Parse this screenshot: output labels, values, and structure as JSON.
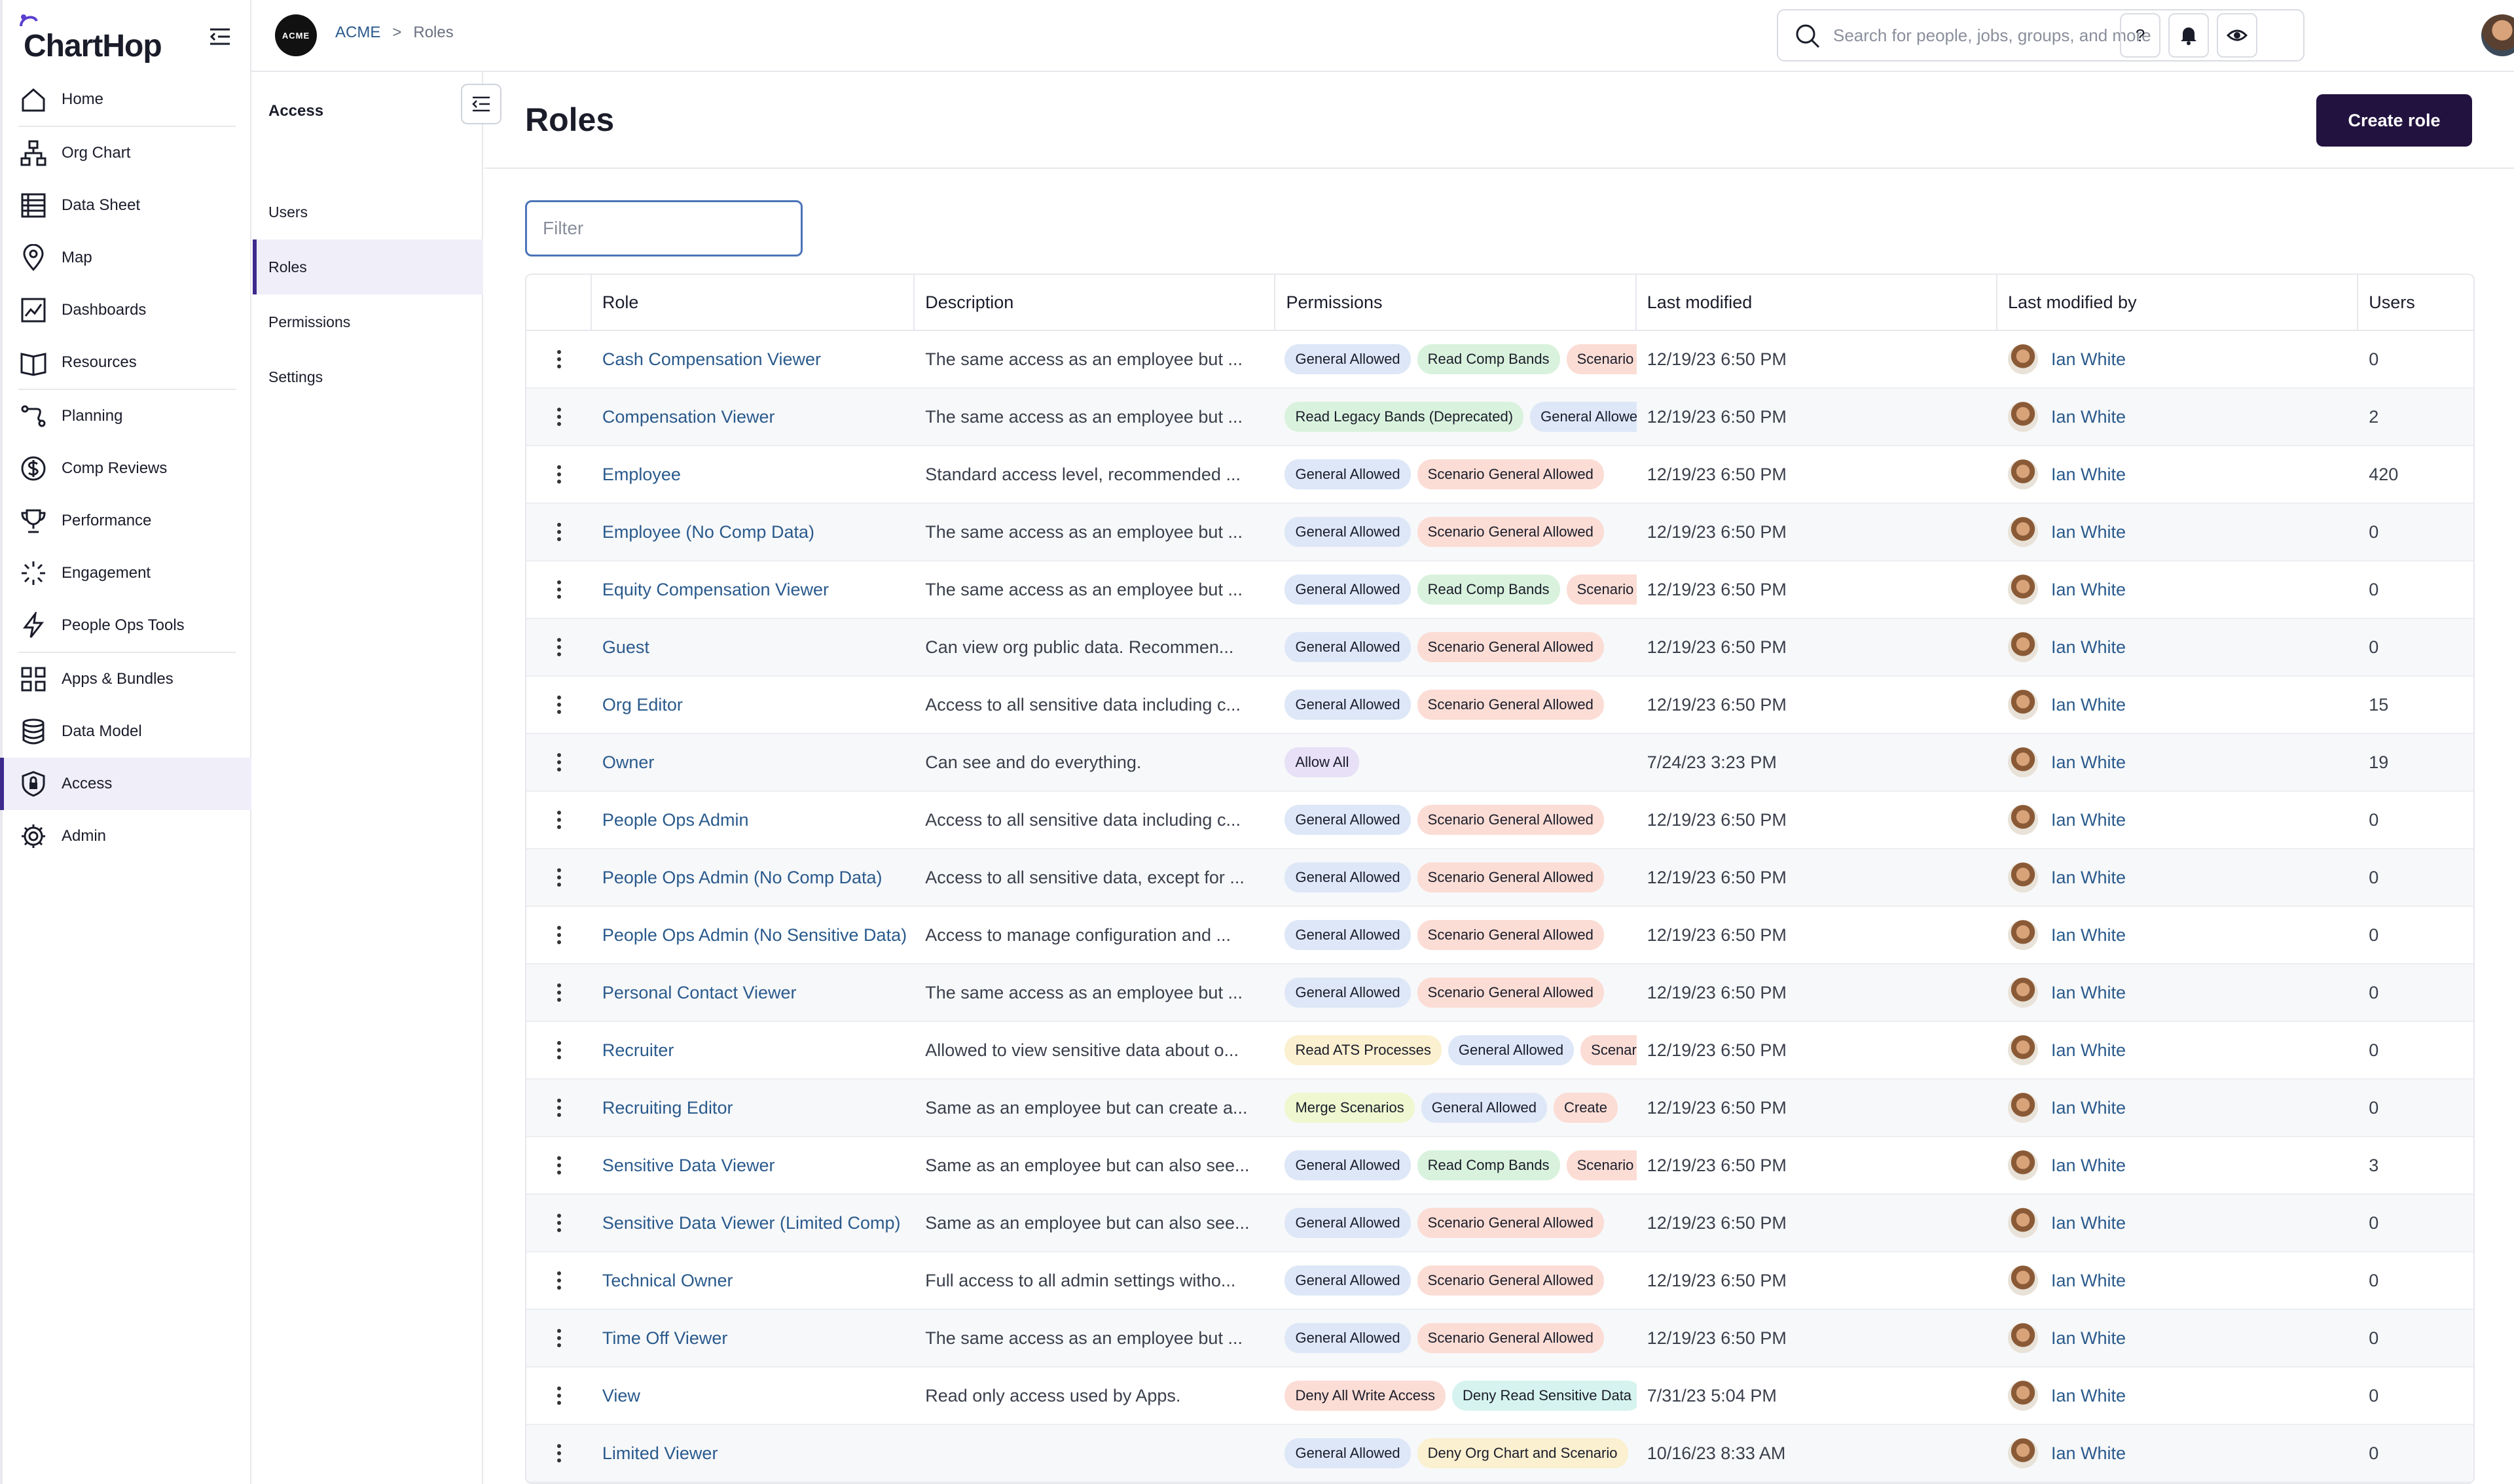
{
  "app": {
    "logo": "ChartHop"
  },
  "nav": {
    "items": [
      {
        "label": "Home",
        "icon": "home-icon"
      },
      {
        "label": "Org Chart",
        "icon": "org-chart-icon"
      },
      {
        "label": "Data Sheet",
        "icon": "table-icon"
      },
      {
        "label": "Map",
        "icon": "map-pin-icon"
      },
      {
        "label": "Dashboards",
        "icon": "dashboard-icon"
      },
      {
        "label": "Resources",
        "icon": "book-icon"
      },
      {
        "label": "Planning",
        "icon": "planning-icon"
      },
      {
        "label": "Comp Reviews",
        "icon": "dollar-icon"
      },
      {
        "label": "Performance",
        "icon": "trophy-icon"
      },
      {
        "label": "Engagement",
        "icon": "engagement-icon"
      },
      {
        "label": "People Ops Tools",
        "icon": "lightning-icon"
      },
      {
        "label": "Apps & Bundles",
        "icon": "apps-icon"
      },
      {
        "label": "Data Model",
        "icon": "database-icon"
      },
      {
        "label": "Access",
        "icon": "shield-icon"
      },
      {
        "label": "Admin",
        "icon": "gear-icon"
      }
    ],
    "active": "Access"
  },
  "topbar": {
    "org_avatar": "ACME",
    "breadcrumb": [
      "ACME",
      ">",
      "Roles"
    ],
    "search_placeholder": "Search for people, jobs, groups, and more",
    "help_label": "?"
  },
  "subnav": {
    "title": "Access",
    "items": [
      "Users",
      "Roles",
      "Permissions",
      "Settings"
    ],
    "active": "Roles"
  },
  "main": {
    "title": "Roles",
    "create_button": "Create role",
    "filter_placeholder": "Filter",
    "columns": [
      "Role",
      "Description",
      "Permissions",
      "Last modified",
      "Last modified by",
      "Users"
    ]
  },
  "tag_colors": {
    "General Allowed": "#dde7f7",
    "Read Comp Bands": "#d9f2dd",
    "Scenario General Allowed": "#fbddd5",
    "Read Legacy Bands (Deprecated)": "#d9f2dd",
    "Allow All": "#e7e0f6",
    "Read ATS Processes": "#fbf0cf",
    "Merge Scenarios": "#eef7cf",
    "Deny All Write Access": "#fbddd5",
    "Deny Read Sensitive Data": "#d6f3ef",
    "Deny Org Chart and Scenario": "#fbf0cf"
  },
  "rows": [
    {
      "role": "Cash Compensation Viewer",
      "desc": "The same access as an employee but ...",
      "perms": [
        "General Allowed",
        "Read Comp Bands",
        "Scenario General Allowed"
      ],
      "modified": "12/19/23 6:50 PM",
      "by": "Ian White",
      "users": "0"
    },
    {
      "role": "Compensation Viewer",
      "desc": "The same access as an employee but ...",
      "perms": [
        "Read Legacy Bands (Deprecated)",
        "General Allowed"
      ],
      "modified": "12/19/23 6:50 PM",
      "by": "Ian White",
      "users": "2"
    },
    {
      "role": "Employee",
      "desc": "Standard access level, recommended ...",
      "perms": [
        "General Allowed",
        "Scenario General Allowed"
      ],
      "modified": "12/19/23 6:50 PM",
      "by": "Ian White",
      "users": "420"
    },
    {
      "role": "Employee (No Comp Data)",
      "desc": "The same access as an employee but ...",
      "perms": [
        "General Allowed",
        "Scenario General Allowed"
      ],
      "modified": "12/19/23 6:50 PM",
      "by": "Ian White",
      "users": "0"
    },
    {
      "role": "Equity Compensation Viewer",
      "desc": "The same access as an employee but ...",
      "perms": [
        "General Allowed",
        "Read Comp Bands",
        "Scenario General Allowed"
      ],
      "modified": "12/19/23 6:50 PM",
      "by": "Ian White",
      "users": "0"
    },
    {
      "role": "Guest",
      "desc": "Can view org public data. Recommen...",
      "perms": [
        "General Allowed",
        "Scenario General Allowed"
      ],
      "modified": "12/19/23 6:50 PM",
      "by": "Ian White",
      "users": "0"
    },
    {
      "role": "Org Editor",
      "desc": "Access to all sensitive data including c...",
      "perms": [
        "General Allowed",
        "Scenario General Allowed"
      ],
      "modified": "12/19/23 6:50 PM",
      "by": "Ian White",
      "users": "15"
    },
    {
      "role": "Owner",
      "desc": "Can see and do everything.",
      "perms": [
        "Allow All"
      ],
      "modified": "7/24/23 3:23 PM",
      "by": "Ian White",
      "users": "19"
    },
    {
      "role": "People Ops Admin",
      "desc": "Access to all sensitive data including c...",
      "perms": [
        "General Allowed",
        "Scenario General Allowed"
      ],
      "modified": "12/19/23 6:50 PM",
      "by": "Ian White",
      "users": "0"
    },
    {
      "role": "People Ops Admin (No Comp Data)",
      "desc": "Access to all sensitive data, except for ...",
      "perms": [
        "General Allowed",
        "Scenario General Allowed"
      ],
      "modified": "12/19/23 6:50 PM",
      "by": "Ian White",
      "users": "0"
    },
    {
      "role": "People Ops Admin (No Sensitive Data)",
      "desc": "Access to manage configuration and ...",
      "perms": [
        "General Allowed",
        "Scenario General Allowed"
      ],
      "modified": "12/19/23 6:50 PM",
      "by": "Ian White",
      "users": "0"
    },
    {
      "role": "Personal Contact Viewer",
      "desc": "The same access as an employee but ...",
      "perms": [
        "General Allowed",
        "Scenario General Allowed"
      ],
      "modified": "12/19/23 6:50 PM",
      "by": "Ian White",
      "users": "0"
    },
    {
      "role": "Recruiter",
      "desc": "Allowed to view sensitive data about o...",
      "perms": [
        "Read ATS Processes",
        "General Allowed",
        "Scenario General Allowed"
      ],
      "modified": "12/19/23 6:50 PM",
      "by": "Ian White",
      "users": "0"
    },
    {
      "role": "Recruiting Editor",
      "desc": "Same as an employee but can create a...",
      "perms": [
        "Merge Scenarios",
        "General Allowed",
        "Create"
      ],
      "modified": "12/19/23 6:50 PM",
      "by": "Ian White",
      "users": "0"
    },
    {
      "role": "Sensitive Data Viewer",
      "desc": "Same as an employee but can also see...",
      "perms": [
        "General Allowed",
        "Read Comp Bands",
        "Scenario General Allowed"
      ],
      "modified": "12/19/23 6:50 PM",
      "by": "Ian White",
      "users": "3"
    },
    {
      "role": "Sensitive Data Viewer (Limited Comp)",
      "desc": "Same as an employee but can also see...",
      "perms": [
        "General Allowed",
        "Scenario General Allowed"
      ],
      "modified": "12/19/23 6:50 PM",
      "by": "Ian White",
      "users": "0"
    },
    {
      "role": "Technical Owner",
      "desc": "Full access to all admin settings witho...",
      "perms": [
        "General Allowed",
        "Scenario General Allowed"
      ],
      "modified": "12/19/23 6:50 PM",
      "by": "Ian White",
      "users": "0"
    },
    {
      "role": "Time Off Viewer",
      "desc": "The same access as an employee but ...",
      "perms": [
        "General Allowed",
        "Scenario General Allowed"
      ],
      "modified": "12/19/23 6:50 PM",
      "by": "Ian White",
      "users": "0"
    },
    {
      "role": "View",
      "desc": "Read only access used by Apps.",
      "perms": [
        "Deny All Write Access",
        "Deny Read Sensitive Data"
      ],
      "modified": "7/31/23 5:04 PM",
      "by": "Ian White",
      "users": "0"
    },
    {
      "role": "Limited Viewer",
      "desc": "",
      "perms": [
        "General Allowed",
        "Deny Org Chart and Scenario"
      ],
      "modified": "10/16/23 8:33 AM",
      "by": "Ian White",
      "users": "0"
    }
  ]
}
